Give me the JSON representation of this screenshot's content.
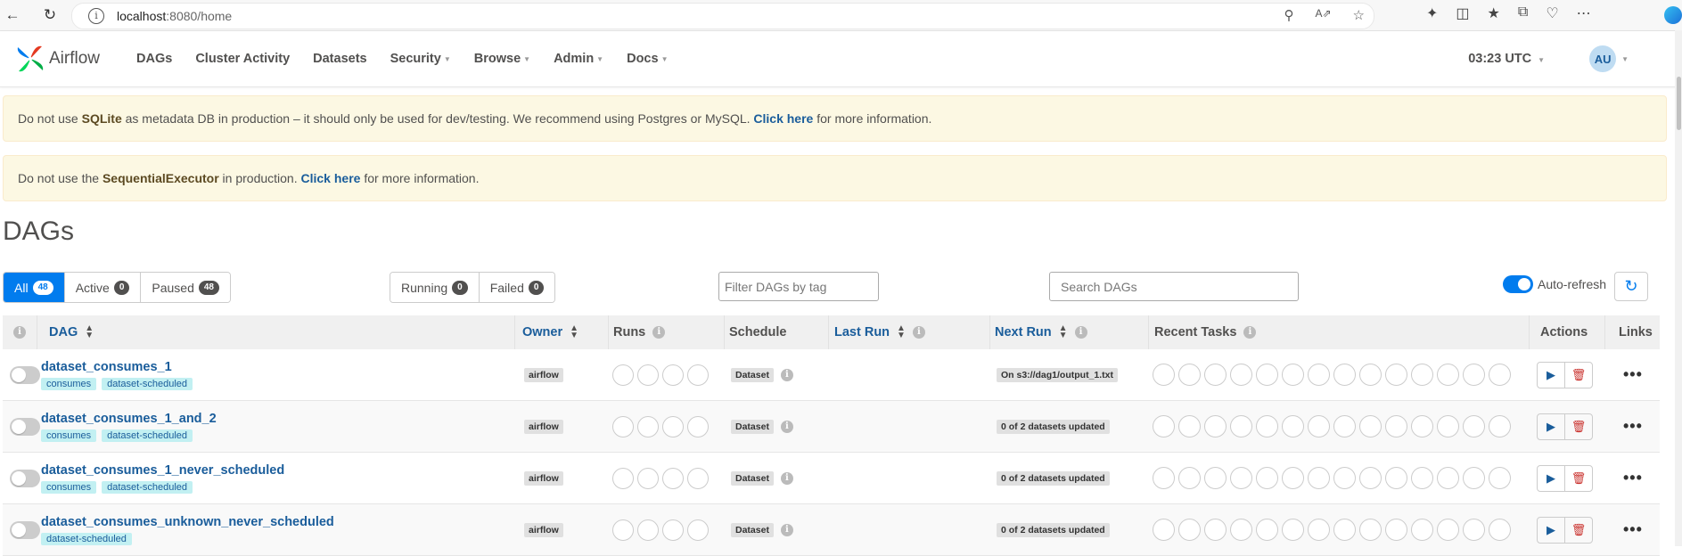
{
  "browser": {
    "url_host": "localhost",
    "url_path": ":8080/home"
  },
  "navbar": {
    "logo_text": "Airflow",
    "items": [
      {
        "label": "DAGs",
        "dropdown": false
      },
      {
        "label": "Cluster Activity",
        "dropdown": false
      },
      {
        "label": "Datasets",
        "dropdown": false
      },
      {
        "label": "Security",
        "dropdown": true
      },
      {
        "label": "Browse",
        "dropdown": true
      },
      {
        "label": "Admin",
        "dropdown": true
      },
      {
        "label": "Docs",
        "dropdown": true
      }
    ],
    "time": "03:23 UTC",
    "avatar": "AU"
  },
  "alerts": {
    "a1_pre": "Do not use ",
    "a1_bold": "SQLite",
    "a1_mid": " as metadata DB in production – it should only be used for dev/testing. We recommend using Postgres or MySQL. ",
    "a1_link": "Click here",
    "a1_post": " for more information.",
    "a2_pre": "Do not use the ",
    "a2_bold": "SequentialExecutor",
    "a2_mid": " in production. ",
    "a2_link": "Click here",
    "a2_post": " for more information."
  },
  "page_title": "DAGs",
  "filters": {
    "all_label": "All",
    "all_count": "48",
    "active_label": "Active",
    "active_count": "0",
    "paused_label": "Paused",
    "paused_count": "48",
    "running_label": "Running",
    "running_count": "0",
    "failed_label": "Failed",
    "failed_count": "0",
    "tag_placeholder": "Filter DAGs by tag",
    "search_placeholder": "Search DAGs",
    "autorefresh_label": "Auto-refresh"
  },
  "table": {
    "headers": {
      "dag": "DAG",
      "owner": "Owner",
      "runs": "Runs",
      "schedule": "Schedule",
      "last_run": "Last Run",
      "next_run": "Next Run",
      "recent_tasks": "Recent Tasks",
      "actions": "Actions",
      "links": "Links"
    },
    "rows": [
      {
        "dag_id": "dataset_consumes_1",
        "tags": [
          "consumes",
          "dataset-scheduled"
        ],
        "owner": "airflow",
        "schedule": "Dataset",
        "next_run": "On s3://dag1/output_1.txt"
      },
      {
        "dag_id": "dataset_consumes_1_and_2",
        "tags": [
          "consumes",
          "dataset-scheduled"
        ],
        "owner": "airflow",
        "schedule": "Dataset",
        "next_run": "0 of 2 datasets updated"
      },
      {
        "dag_id": "dataset_consumes_1_never_scheduled",
        "tags": [
          "consumes",
          "dataset-scheduled"
        ],
        "owner": "airflow",
        "schedule": "Dataset",
        "next_run": "0 of 2 datasets updated"
      },
      {
        "dag_id": "dataset_consumes_unknown_never_scheduled",
        "tags": [
          "dataset-scheduled"
        ],
        "owner": "airflow",
        "schedule": "Dataset",
        "next_run": "0 of 2 datasets updated"
      }
    ]
  },
  "colors": {
    "primary": "#017cee",
    "link": "#1a5d9b",
    "alert_bg": "#fcf8e3",
    "tag_bg": "#c2f0f2",
    "delete": "#c9302c"
  }
}
